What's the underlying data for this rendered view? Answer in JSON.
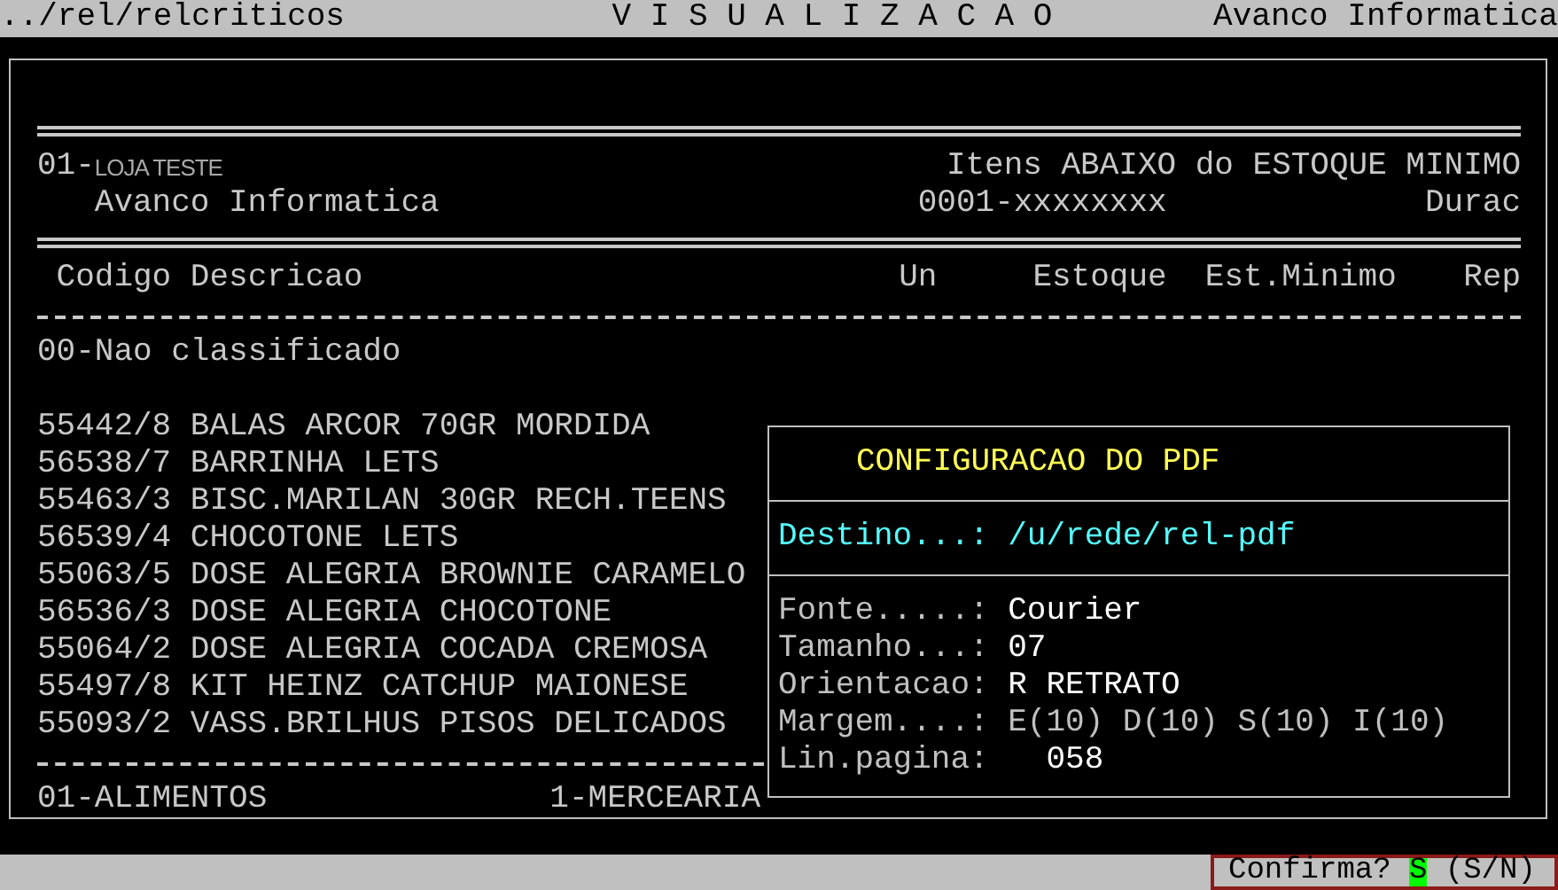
{
  "header_bar": {
    "path": "../rel/relcriticos",
    "title": "V I S U A L I Z A C A O",
    "company": "Avanco Informatica"
  },
  "report": {
    "store_code": "01-",
    "store_name": "LOJA TESTE",
    "report_title": "Itens ABAIXO do ESTOQUE MINIMO",
    "company": "Avanco Informatica",
    "code": "0001-xxxxxxxx",
    "column_right": "Durac",
    "columns": [
      "Codigo",
      "Descricao",
      "Un",
      "Estoque",
      "Est.Minimo",
      "Rep"
    ],
    "group": "00-Nao classificado",
    "rows": [
      {
        "code": "55442/8",
        "description": "BALAS ARCOR 70GR MORDIDA"
      },
      {
        "code": "56538/7",
        "description": "BARRINHA LETS"
      },
      {
        "code": "55463/3",
        "description": "BISC.MARILAN 30GR RECH.TEENS"
      },
      {
        "code": "56539/4",
        "description": "CHOCOTONE LETS"
      },
      {
        "code": "55063/5",
        "description": "DOSE ALEGRIA BROWNIE CARAMELO"
      },
      {
        "code": "56536/3",
        "description": "DOSE ALEGRIA CHOCOTONE"
      },
      {
        "code": "55064/2",
        "description": "DOSE ALEGRIA COCADA CREMOSA"
      },
      {
        "code": "55497/8",
        "description": "KIT HEINZ CATCHUP MAIONESE"
      },
      {
        "code": "55093/2",
        "description": "VASS.BRILHUS PISOS DELICADOS"
      }
    ],
    "footer": {
      "section": "01-ALIMENTOS",
      "department": "1-MERCEARIA"
    }
  },
  "pdf_dialog": {
    "title": "CONFIGURACAO DO PDF",
    "destination": {
      "label": "Destino...:",
      "value": "/u/rede/rel-pdf"
    },
    "fields": [
      {
        "label": "Fonte.....:",
        "value": "Courier",
        "dimmed": false
      },
      {
        "label": "Tamanho...:",
        "value": "07",
        "dimmed": false
      },
      {
        "label": "Orientacao:",
        "value": "R RETRATO",
        "dimmed": false
      },
      {
        "label": "Margem....:",
        "value": "E(10) D(10) S(10) I(10)",
        "dimmed": true
      },
      {
        "label": "Lin.pagina:",
        "value": "  058",
        "dimmed": false
      }
    ]
  },
  "prompt": {
    "label": "Confirma?",
    "value": "S",
    "hint": "(S/N)"
  }
}
